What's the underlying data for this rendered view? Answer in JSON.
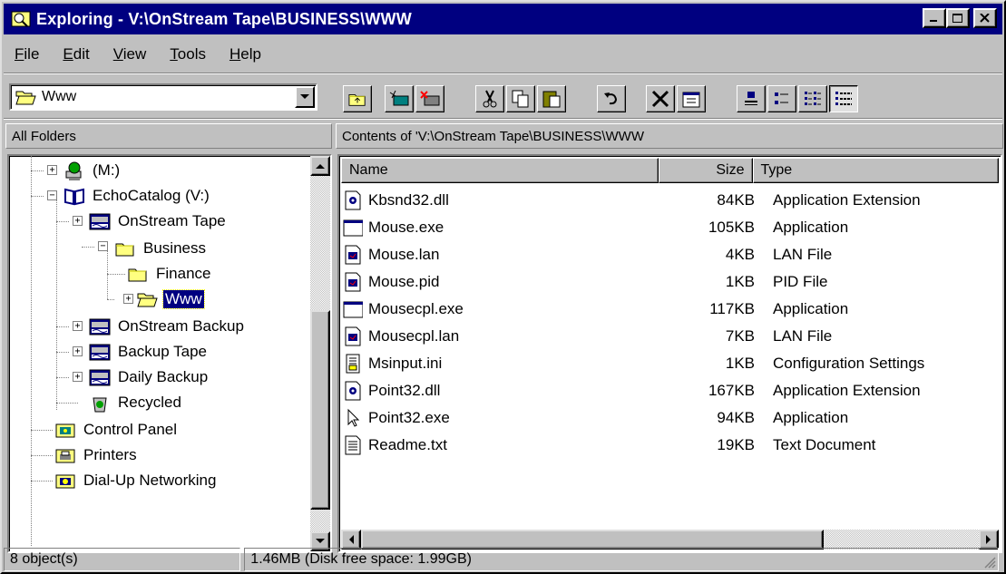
{
  "window": {
    "title": "Exploring - V:\\OnStream Tape\\BUSINESS\\WWW"
  },
  "menu": [
    {
      "label": "File",
      "accel": "F",
      "rest": "ile"
    },
    {
      "label": "Edit",
      "accel": "E",
      "rest": "dit"
    },
    {
      "label": "View",
      "accel": "V",
      "rest": "iew"
    },
    {
      "label": "Tools",
      "accel": "T",
      "rest": "ools"
    },
    {
      "label": "Help",
      "accel": "H",
      "rest": "elp"
    }
  ],
  "address": {
    "value": "Www",
    "icon": "open-folder-icon"
  },
  "toolbar": {
    "buttons": [
      "up-one-level",
      "map-network-drive",
      "disconnect-network-drive",
      "cut",
      "copy",
      "paste",
      "undo",
      "delete",
      "properties",
      "large-icons",
      "small-icons",
      "list",
      "details"
    ],
    "pressed": "details"
  },
  "left_header": "All Folders",
  "right_header": "Contents of 'V:\\OnStream Tape\\BUSINESS\\WWW",
  "tree": [
    {
      "label": "(M:)",
      "icon": "network-drive-icon"
    },
    {
      "label": "EchoCatalog (V:)",
      "icon": "book-drive-icon"
    },
    {
      "label": "OnStream Tape",
      "icon": "tape-drive-icon"
    },
    {
      "label": "Business",
      "icon": "folder-icon"
    },
    {
      "label": "Finance",
      "icon": "folder-icon"
    },
    {
      "label": "Www",
      "icon": "open-folder-icon",
      "selected": true
    },
    {
      "label": "OnStream Backup",
      "icon": "tape-drive-icon"
    },
    {
      "label": "Backup Tape",
      "icon": "tape-drive-icon"
    },
    {
      "label": "Daily Backup",
      "icon": "tape-drive-icon"
    },
    {
      "label": "Recycled",
      "icon": "recycle-bin-icon"
    },
    {
      "label": "Control Panel",
      "icon": "control-panel-icon"
    },
    {
      "label": "Printers",
      "icon": "printers-icon"
    },
    {
      "label": "Dial-Up Networking",
      "icon": "dialup-icon"
    }
  ],
  "columns": {
    "name": "Name",
    "size": "Size",
    "type": "Type"
  },
  "files": [
    {
      "name": "Kbsnd32.dll",
      "size": "84KB",
      "type": "Application Extension",
      "icon": "dll-icon"
    },
    {
      "name": "Mouse.exe",
      "size": "105KB",
      "type": "Application",
      "icon": "exe-icon"
    },
    {
      "name": "Mouse.lan",
      "size": "4KB",
      "type": "LAN File",
      "icon": "file-icon"
    },
    {
      "name": "Mouse.pid",
      "size": "1KB",
      "type": "PID File",
      "icon": "file-icon"
    },
    {
      "name": "Mousecpl.exe",
      "size": "117KB",
      "type": "Application",
      "icon": "exe-icon"
    },
    {
      "name": "Mousecpl.lan",
      "size": "7KB",
      "type": "LAN File",
      "icon": "file-icon"
    },
    {
      "name": "Msinput.ini",
      "size": "1KB",
      "type": "Configuration Settings",
      "icon": "ini-icon"
    },
    {
      "name": "Point32.dll",
      "size": "167KB",
      "type": "Application Extension",
      "icon": "dll-icon"
    },
    {
      "name": "Point32.exe",
      "size": "94KB",
      "type": "Application",
      "icon": "pointer-exe-icon"
    },
    {
      "name": "Readme.txt",
      "size": "19KB",
      "type": "Text Document",
      "icon": "text-document-icon"
    }
  ],
  "status": {
    "objects": "8 object(s)",
    "size": "1.46MB (Disk free space: 1.99GB)"
  }
}
